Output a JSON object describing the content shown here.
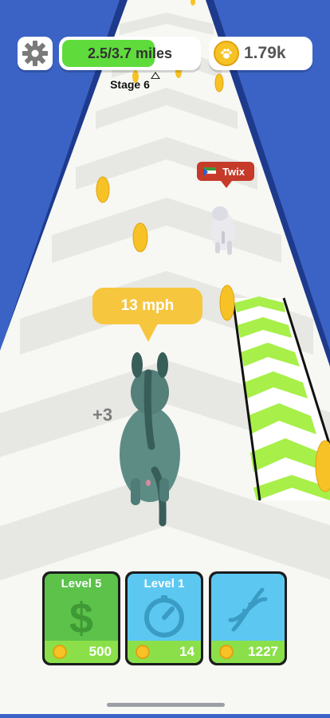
{
  "hud": {
    "settings_icon": "gear-icon",
    "progress_text": "2.5/3.7 miles",
    "progress_fraction": 0.68,
    "coins_text": "1.79k",
    "coin_icon": "paw-coin-icon"
  },
  "stage_label": "Stage 6",
  "rival": {
    "name": "Twix"
  },
  "player": {
    "speed_text": "13 mph",
    "bonus_text": "+3"
  },
  "upgrades": [
    {
      "title": "Level 5",
      "icon": "dollar-icon",
      "price": "500",
      "color": "#5cc24a",
      "foot_color": "#8be04a"
    },
    {
      "title": "Level 1",
      "icon": "speedometer-icon",
      "price": "14",
      "color": "#5cc8f2",
      "foot_color": "#8be04a"
    },
    {
      "title": "",
      "icon": "dna-icon",
      "price": "1227",
      "color": "#5cc8f2",
      "foot_color": "#8be04a"
    }
  ],
  "colors": {
    "sky_side": "#3b63c5",
    "track": "#f7f7f4",
    "chevron": "#e6e6e2",
    "boost_strip": "#a8ef4a",
    "coin": "#f6c226"
  }
}
